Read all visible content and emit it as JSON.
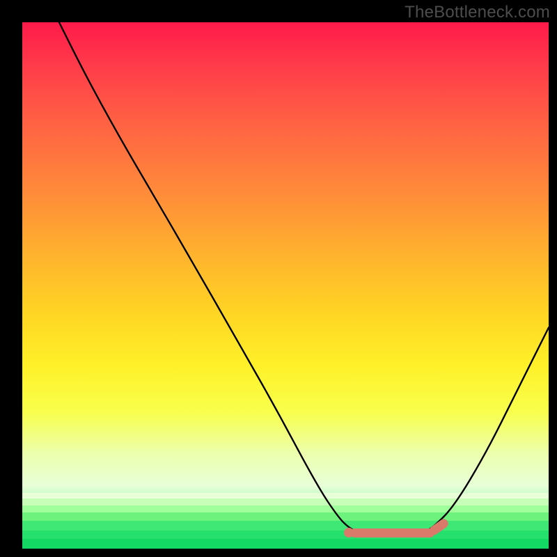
{
  "watermark": "TheBottleneck.com",
  "chart_data": {
    "type": "line",
    "title": "",
    "xlabel": "",
    "ylabel": "",
    "xlim": [
      0,
      100
    ],
    "ylim": [
      0,
      100
    ],
    "grid": false,
    "series": [
      {
        "name": "bottleneck-curve",
        "x": [
          7,
          12,
          18,
          25,
          32,
          40,
          48,
          56,
          60,
          62,
          64,
          70,
          76,
          78,
          82,
          88,
          94,
          100
        ],
        "y": [
          100,
          90,
          79,
          67,
          55,
          41,
          27,
          12,
          6,
          4,
          3,
          3,
          3,
          4,
          8,
          18,
          30,
          42
        ],
        "color": "#000000"
      }
    ],
    "optimal_range": {
      "x_start": 62,
      "x_end": 78,
      "y": 3
    },
    "background_gradient": {
      "direction": "vertical",
      "stops": [
        {
          "pos": 0,
          "color": "#ff1a4a"
        },
        {
          "pos": 50,
          "color": "#ffd424"
        },
        {
          "pos": 100,
          "color": "#14d864"
        }
      ]
    }
  }
}
